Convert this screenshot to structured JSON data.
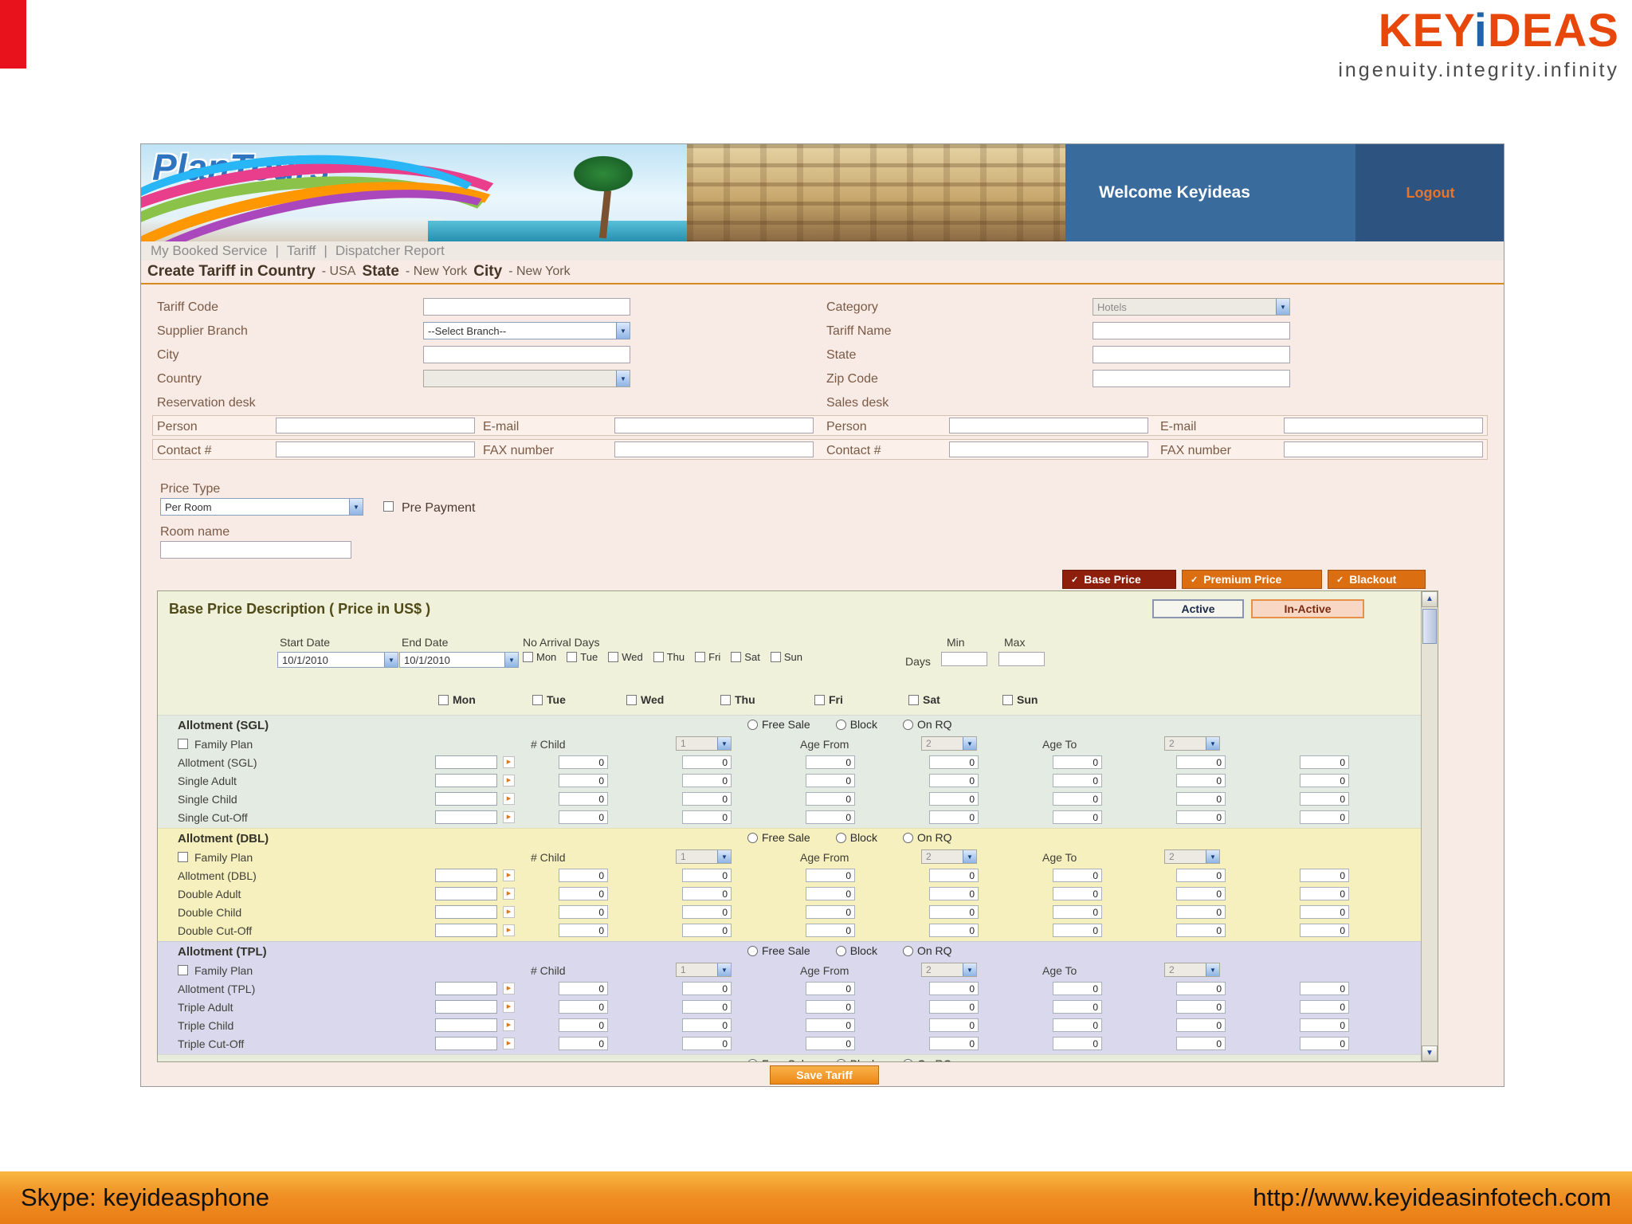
{
  "brand": {
    "logo_key": "KEY",
    "logo_i": "i",
    "logo_deas": "DEAS",
    "tagline": "ingenuity.integrity.infinity"
  },
  "footer": {
    "skype": "Skype: keyideasphone",
    "url": "http://www.keyideasinfotech.com"
  },
  "icons": {
    "dropdown_arrow": "▼",
    "copy_glyph": "▸",
    "scroll_up": "▲",
    "scroll_down": "▼",
    "tab_glyph": "✓"
  },
  "colors": {
    "brand_orange": "#e8470b",
    "brand_blue": "#1f63a8",
    "header_blue": "#3a6b9d",
    "tab_selected": "#8e1f0c",
    "tab_orange": "#dc6e12",
    "section_sgl": "#e3ebe2",
    "section_dbl": "#f6efbe",
    "section_tpl": "#dad8ec",
    "accent_line": "#d98a1e",
    "footer_orange": "#f09025"
  },
  "app": {
    "header": {
      "brand": "PlanTours",
      "welcome": "Welcome Keyideas",
      "logout": "Logout"
    },
    "nav": {
      "items": [
        "My Booked Service",
        "Tariff",
        "Dispatcher Report"
      ],
      "sep": "|"
    },
    "title": {
      "create": "Create Tariff in Country",
      "country_val": "- USA",
      "state_lbl": "State",
      "state_val": "- New York",
      "city_lbl": "City",
      "city_val": "- New York"
    },
    "form": {
      "tariff_code": "Tariff Code",
      "supplier_branch": "Supplier Branch",
      "supplier_branch_value": "--Select Branch--",
      "city": "City",
      "country": "Country",
      "category": "Category",
      "category_value": "Hotels",
      "tariff_name": "Tariff Name",
      "state": "State",
      "zip": "Zip Code",
      "reservation_desk": "Reservation desk",
      "sales_desk": "Sales desk",
      "person": "Person",
      "email": "E-mail",
      "contact": "Contact #",
      "fax": "FAX number",
      "price_type": "Price Type",
      "price_type_value": "Per Room",
      "pre_payment": "Pre Payment",
      "room_name": "Room name"
    },
    "tabs": [
      {
        "label": "Base Price"
      },
      {
        "label": "Premium Price"
      },
      {
        "label": "Blackout"
      }
    ],
    "panel": {
      "title": "Base Price Description ( Price in US$ )",
      "active": "Active",
      "inactive": "In-Active",
      "start_date": "Start Date",
      "start_date_value": "10/1/2010",
      "end_date": "End Date",
      "end_date_value": "10/1/2010",
      "no_arrival": "No Arrival Days",
      "days_label": "Days",
      "min": "Min",
      "max": "Max",
      "weekdays": [
        "Mon",
        "Tue",
        "Wed",
        "Thu",
        "Fri",
        "Sat",
        "Sun"
      ],
      "radios": [
        "Free Sale",
        "Block",
        "On RQ"
      ],
      "family_plan": "Family Plan",
      "child": "# Child",
      "child_value": "1",
      "age_from": "Age From",
      "age_from_value": "2",
      "age_to": "Age To",
      "age_to_value": "2",
      "cell_value": "0",
      "sections": [
        {
          "header": "Allotment (SGL)",
          "rows": [
            "Allotment (SGL)",
            "Single Adult",
            "Single Child",
            "Single Cut-Off"
          ]
        },
        {
          "header": "Allotment (DBL)",
          "rows": [
            "Allotment (DBL)",
            "Double Adult",
            "Double Child",
            "Double Cut-Off"
          ]
        },
        {
          "header": "Allotment (TPL)",
          "rows": [
            "Allotment (TPL)",
            "Triple Adult",
            "Triple Child",
            "Triple Cut-Off"
          ]
        }
      ],
      "save": "Save Tariff"
    }
  }
}
